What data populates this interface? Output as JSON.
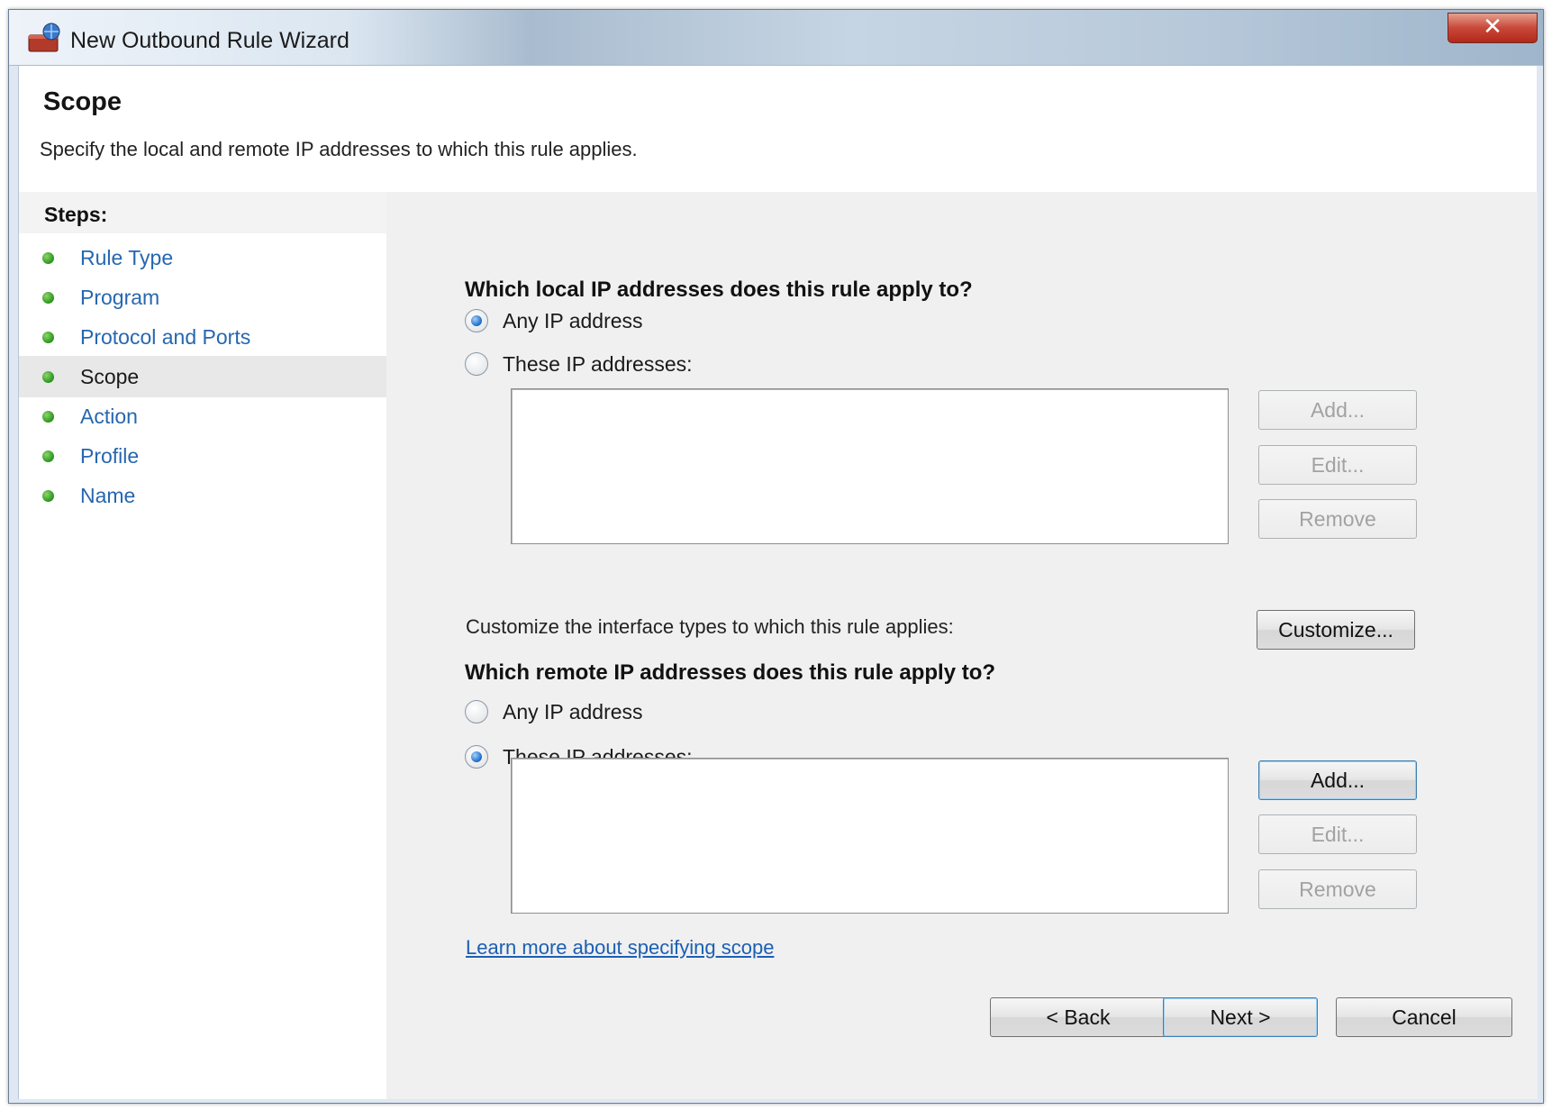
{
  "window": {
    "title": "New Outbound Rule Wizard",
    "close_glyph": "✕",
    "accent_color": "#2667b0"
  },
  "header": {
    "title": "Scope",
    "subtitle": "Specify the local and remote IP addresses to which this rule applies."
  },
  "steps": {
    "heading": "Steps:",
    "items": [
      {
        "label": "Rule Type",
        "current": false
      },
      {
        "label": "Program",
        "current": false
      },
      {
        "label": "Protocol and Ports",
        "current": false
      },
      {
        "label": "Scope",
        "current": true
      },
      {
        "label": "Action",
        "current": false
      },
      {
        "label": "Profile",
        "current": false
      },
      {
        "label": "Name",
        "current": false
      }
    ],
    "bullet_icon": "green-dot-icon"
  },
  "local": {
    "question": "Which local IP addresses does this rule apply to?",
    "any_label": "Any IP address",
    "these_label": "These IP addresses:",
    "selected": "any",
    "buttons": {
      "add": "Add...",
      "edit": "Edit...",
      "remove": "Remove"
    },
    "entries": []
  },
  "customize": {
    "text": "Customize the interface types to which this rule applies:",
    "button": "Customize..."
  },
  "remote": {
    "question": "Which remote IP addresses does this rule apply to?",
    "any_label": "Any IP address",
    "these_label": "These IP addresses:",
    "selected": "these",
    "buttons": {
      "add": "Add...",
      "edit": "Edit...",
      "remove": "Remove"
    },
    "entries": []
  },
  "learn_more": "Learn more about specifying scope",
  "footer": {
    "back": "< Back",
    "next": "Next >",
    "cancel": "Cancel"
  }
}
